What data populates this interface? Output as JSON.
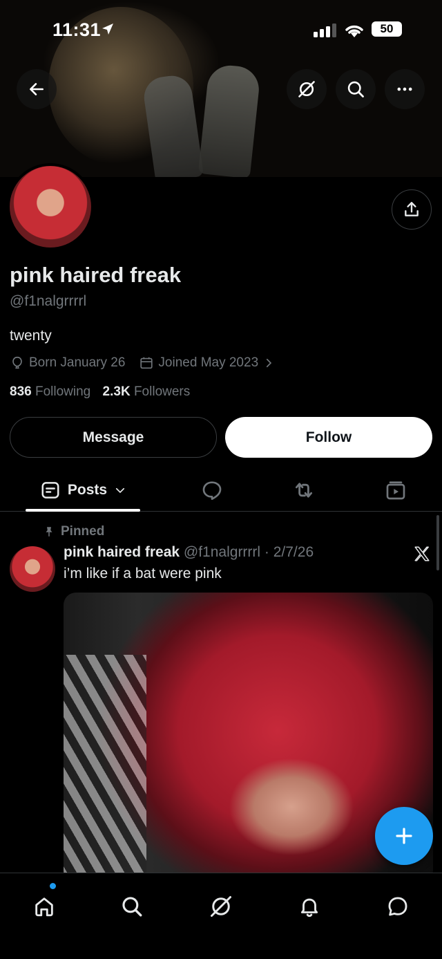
{
  "status_bar": {
    "time": "11:31",
    "battery": "50"
  },
  "header": {
    "icons": [
      "back-arrow-icon",
      "grok-icon",
      "search-icon",
      "more-icon"
    ]
  },
  "profile": {
    "display_name": "pink haired freak",
    "handle": "@f1nalgrrrrl",
    "bio": "twenty",
    "birthday": "Born January 26",
    "joined": "Joined May 2023",
    "following_count": "836",
    "following_label": "Following",
    "followers_count": "2.3K",
    "followers_label": "Followers"
  },
  "actions": {
    "message_label": "Message",
    "follow_label": "Follow"
  },
  "tabs": {
    "posts_label": "Posts",
    "icons": [
      "posts-icon",
      "replies-icon",
      "reposts-icon",
      "media-icon"
    ]
  },
  "pinned_post": {
    "pinned_label": "Pinned",
    "author_name": "pink haired freak",
    "author_meta": "@f1nalgrrrrl · 2/7/26",
    "text": "i’m like if a bat were pink"
  },
  "bottom_nav": {
    "icons": [
      "home-icon",
      "search-icon",
      "grok-icon",
      "notifications-icon",
      "messages-icon"
    ]
  },
  "colors": {
    "accent": "#1d9bf0",
    "background": "#000000",
    "muted_text": "#71767b"
  }
}
